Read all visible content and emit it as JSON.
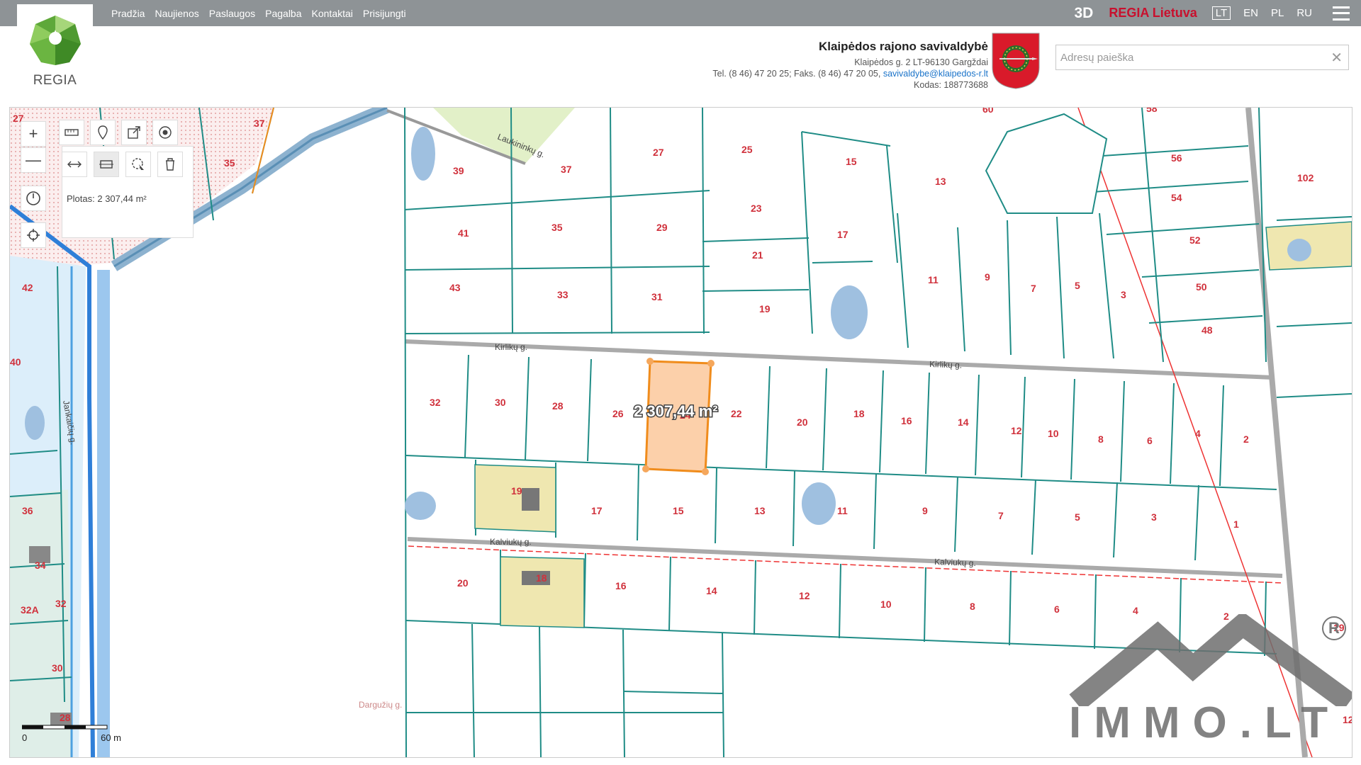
{
  "nav": {
    "items": [
      "Pradžia",
      "Naujienos",
      "Paslaugos",
      "Pagalba",
      "Kontaktai",
      "Prisijungti"
    ]
  },
  "top_right": {
    "btn3d": "3D",
    "regia": "REGIA Lietuva",
    "langs": [
      "LT",
      "EN",
      "PL",
      "RU"
    ],
    "active_lang": "LT"
  },
  "logo": {
    "text": "REGIA"
  },
  "municipality": {
    "name": "Klaipėdos rajono savivaldybė",
    "address": "Klaipėdos g. 2 LT-96130 Gargždai",
    "phone": "Tel. (8 46) 47 20 25; Faks. (8 46) 47 20 05,",
    "email": "savivaldybe@klaipedos-r.lt",
    "code": "Kodas: 188773688"
  },
  "search": {
    "placeholder": "Adresų paieška",
    "clear": "✕"
  },
  "tools": {
    "zoom_in": "+",
    "zoom_out": "—",
    "area": "Plotas: 2 307,44 m²"
  },
  "measure": {
    "label": "2 307,44 m²"
  },
  "scale": {
    "start": "0",
    "end": "60 m"
  },
  "streets": {
    "kirliku1": "Kirlikų g.",
    "kirliku2": "Kirlikų g.",
    "kalviuku1": "Kalviukų g.",
    "kalviuku2": "Kalviukų g.",
    "laukininku": "Laukininkų g.",
    "jankaiciu": "Jankaičių g.",
    "darguziu": "Dargužių g."
  },
  "parcels": {
    "row1": [
      "39",
      "37",
      "27",
      "25",
      "15",
      "13",
      "56",
      "102"
    ],
    "row2": [
      "41",
      "35",
      "29",
      "23",
      "17",
      "54",
      "52"
    ],
    "row3": [
      "43",
      "33",
      "31",
      "21",
      "19",
      "11",
      "9",
      "7",
      "5",
      "3",
      "50",
      "48"
    ],
    "row4": [
      "32",
      "30",
      "28",
      "26",
      "22",
      "20",
      "18",
      "16",
      "14",
      "12",
      "10",
      "8",
      "6",
      "4",
      "2"
    ],
    "row5": [
      "19",
      "17",
      "15",
      "13",
      "11",
      "9",
      "7",
      "5",
      "3",
      "1"
    ],
    "row6": [
      "20",
      "18",
      "16",
      "14",
      "12",
      "10",
      "8",
      "6",
      "4",
      "2"
    ],
    "left": [
      "42",
      "40",
      "36",
      "34",
      "32A",
      "32",
      "30",
      "28",
      "27",
      "35",
      "37"
    ],
    "selected": "24",
    "top_cut": [
      "60",
      "58"
    ],
    "right": [
      "19",
      "12"
    ]
  },
  "watermark": {
    "text": "IMMO.LT"
  },
  "colors": {
    "parcel_line": "#1f8c86",
    "selected_fill": "#fcd0aa",
    "selected_stroke": "#f08c1c",
    "water": "#9fc0e0",
    "road_blue": "#2f7fd8",
    "built": "#efe7b0"
  }
}
